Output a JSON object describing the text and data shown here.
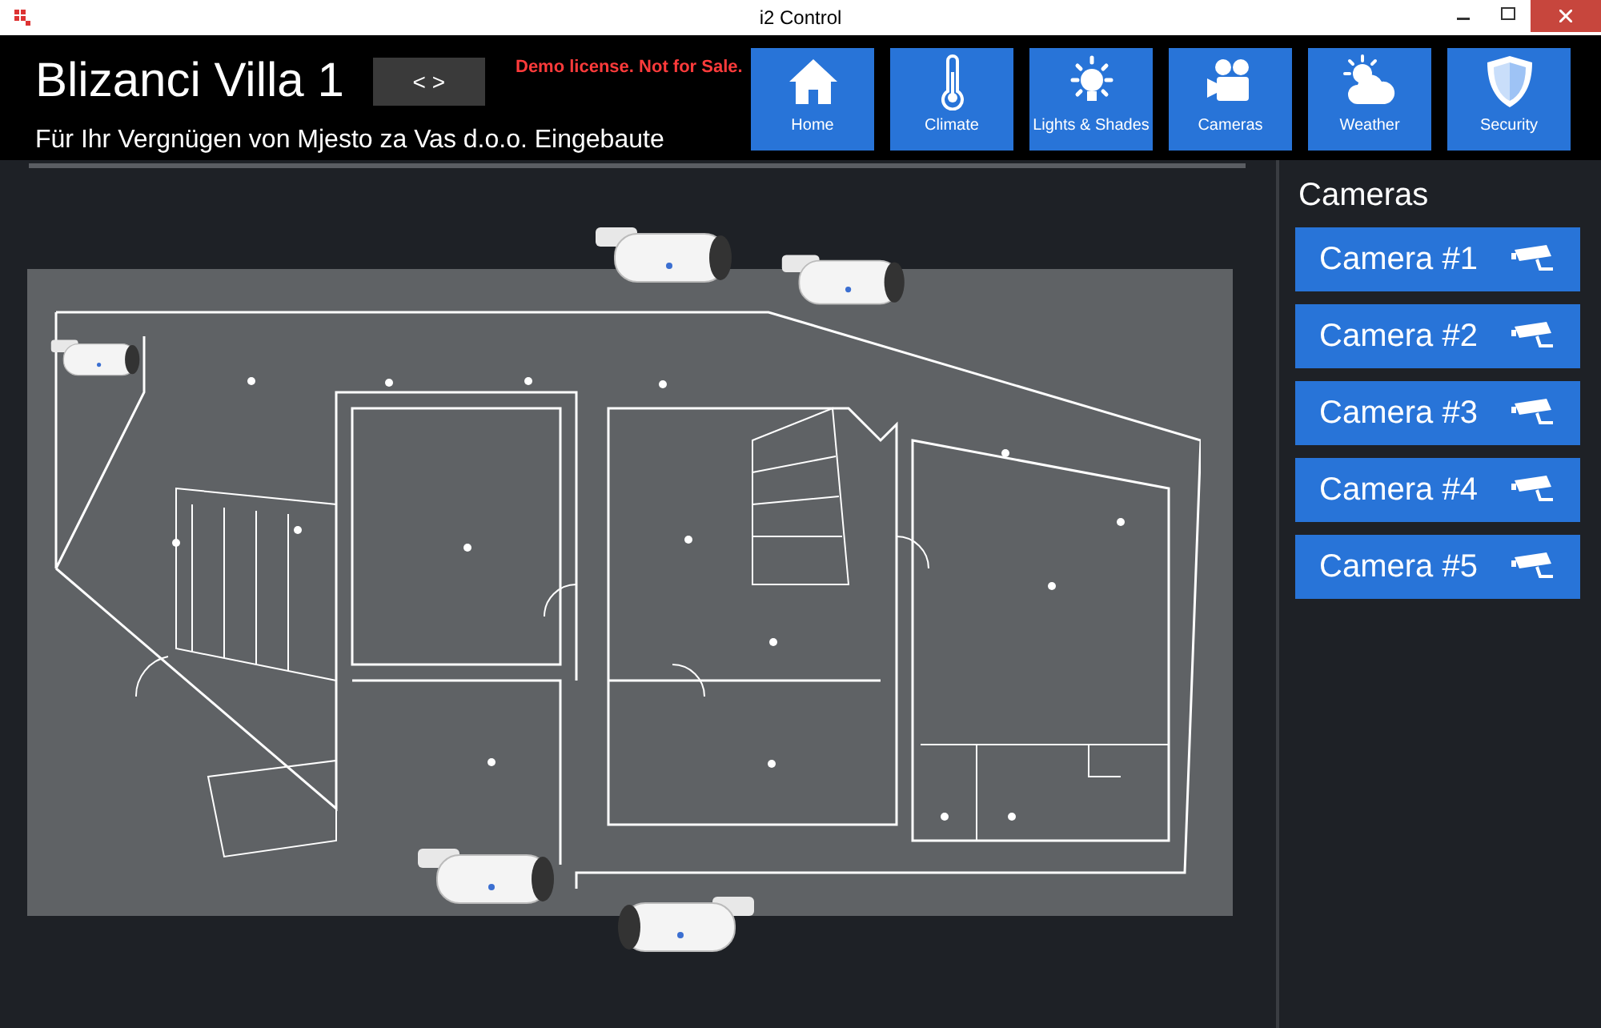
{
  "window": {
    "title": "i2 Control"
  },
  "header": {
    "title": "Blizanci Villa 1",
    "pager": "< >",
    "subtitle": "Für Ihr Vergnügen von Mjesto za Vas d.o.o. Eingebaute",
    "notice": "Demo license. Not for Sale."
  },
  "nav": [
    {
      "label": "Home",
      "kind": "home"
    },
    {
      "label": "Climate",
      "kind": "climate"
    },
    {
      "label": "Lights & Shades",
      "kind": "lights"
    },
    {
      "label": "Cameras",
      "kind": "cameras"
    },
    {
      "label": "Weather",
      "kind": "weather"
    },
    {
      "label": "Security",
      "kind": "security"
    }
  ],
  "sidebar": {
    "title": "Cameras",
    "items": [
      "Camera #1",
      "Camera #2",
      "Camera #3",
      "Camera #4",
      "Camera #5"
    ]
  }
}
